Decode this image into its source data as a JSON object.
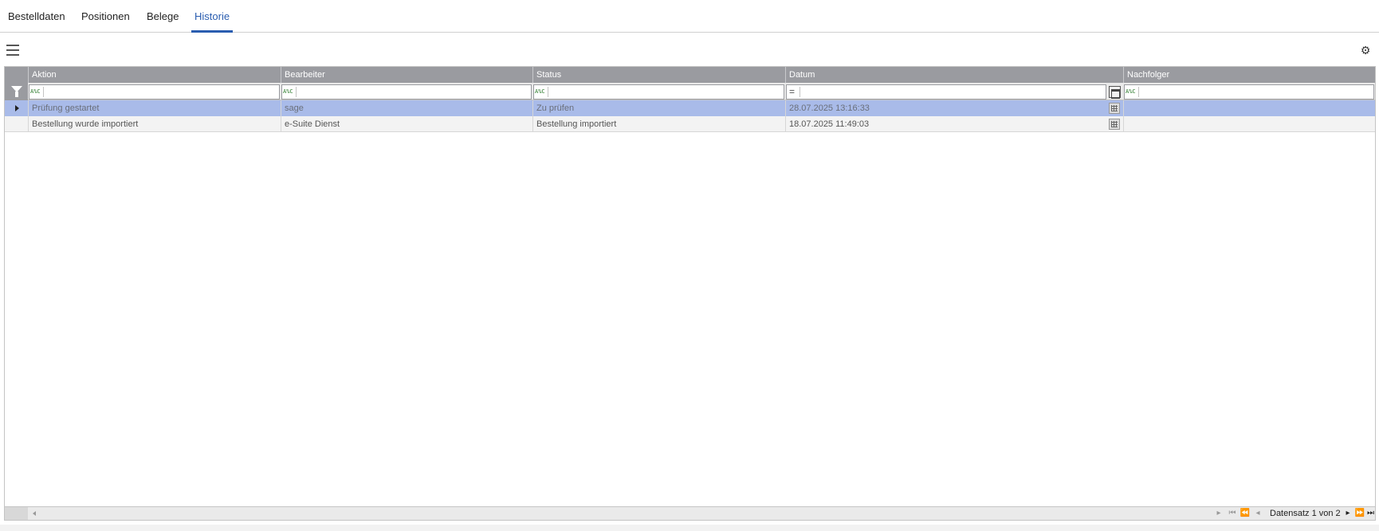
{
  "tabs": [
    {
      "label": "Bestelldaten"
    },
    {
      "label": "Positionen"
    },
    {
      "label": "Belege"
    },
    {
      "label": "Historie"
    }
  ],
  "active_tab": "Historie",
  "grid": {
    "columns": [
      {
        "label": "Aktion"
      },
      {
        "label": "Bearbeiter"
      },
      {
        "label": "Status"
      },
      {
        "label": "Datum"
      },
      {
        "label": "Nachfolger"
      }
    ],
    "filter_op_text": "A%C",
    "filter_eq": "=",
    "rows": [
      {
        "aktion": "Prüfung gestartet",
        "bearbeiter": "sage",
        "status": "Zu prüfen",
        "datum": "28.07.2025 13:16:33",
        "nachfolger": "",
        "selected": true
      },
      {
        "aktion": "Bestellung wurde importiert",
        "bearbeiter": "e-Suite Dienst",
        "status": "Bestellung importiert",
        "datum": "18.07.2025 11:49:03",
        "nachfolger": "",
        "selected": false
      }
    ],
    "record_info": "Datensatz 1 von 2"
  },
  "icons": {
    "menu": "hamburger-icon",
    "settings": "gear-icon",
    "filter": "funnel-icon",
    "calendar": "calendar-icon"
  },
  "colors": {
    "accent": "#2a5db0",
    "header_bg": "#9a9ba0",
    "selected_row": "#a9bbe9"
  }
}
